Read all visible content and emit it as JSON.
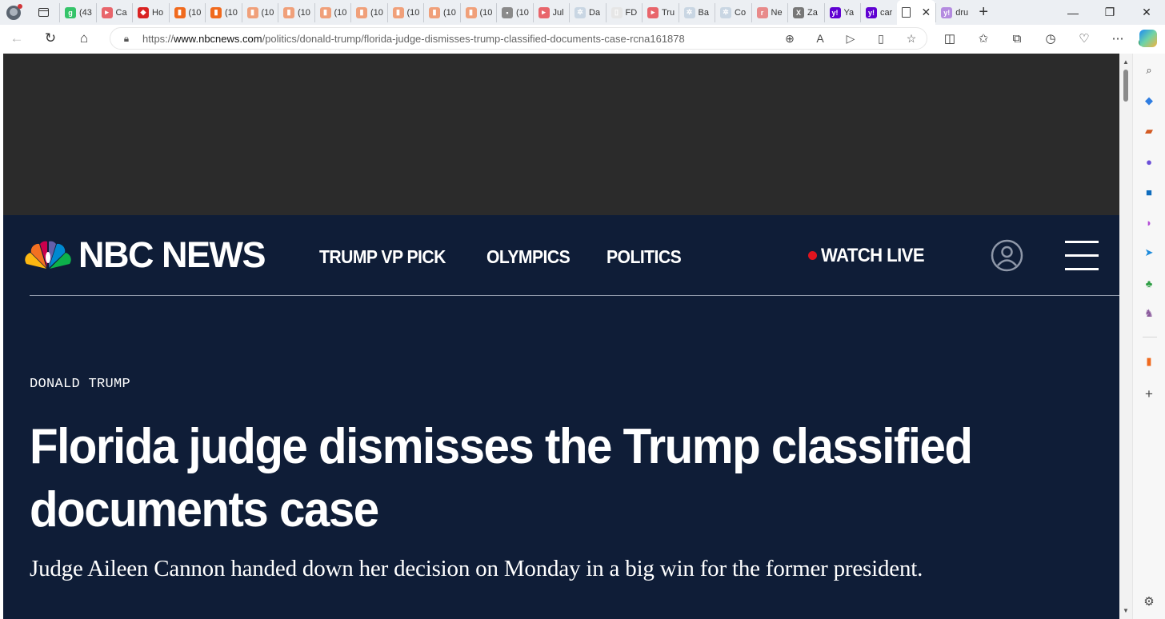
{
  "browser": {
    "tabs": [
      {
        "label": "(43",
        "color": "#35c46a",
        "glyph": "g"
      },
      {
        "label": "Ca",
        "color": "#e8656b",
        "glyph": "▸"
      },
      {
        "label": "Ho",
        "color": "#d92323",
        "glyph": "◆"
      },
      {
        "label": "(10",
        "color": "#f06a1e",
        "glyph": "▮"
      },
      {
        "label": "(10",
        "color": "#f06a1e",
        "glyph": "▮"
      },
      {
        "label": "(10",
        "color": "#f0a07a",
        "glyph": "▮"
      },
      {
        "label": "(10",
        "color": "#f0a07a",
        "glyph": "▮"
      },
      {
        "label": "(10",
        "color": "#f0a07a",
        "glyph": "▮"
      },
      {
        "label": "(10",
        "color": "#f0a07a",
        "glyph": "▮"
      },
      {
        "label": "(10",
        "color": "#f0a07a",
        "glyph": "▮"
      },
      {
        "label": "(10",
        "color": "#f0a07a",
        "glyph": "▮"
      },
      {
        "label": "(10",
        "color": "#f0a07a",
        "glyph": "▮"
      },
      {
        "label": "(10",
        "color": "#8a8a8a",
        "glyph": "▪"
      },
      {
        "label": "Jul",
        "color": "#e8656b",
        "glyph": "▸"
      },
      {
        "label": "Da",
        "color": "#c9d6e3",
        "glyph": "✲"
      },
      {
        "label": "FD",
        "color": "#e6e6e6",
        "glyph": "▯"
      },
      {
        "label": "Tru",
        "color": "#e8656b",
        "glyph": "▸"
      },
      {
        "label": "Ba",
        "color": "#c9d6e3",
        "glyph": "✲"
      },
      {
        "label": "Co",
        "color": "#c9d6e3",
        "glyph": "✲"
      },
      {
        "label": "Ne",
        "color": "#e88a8a",
        "glyph": "r"
      },
      {
        "label": "Za",
        "color": "#777777",
        "glyph": "X"
      },
      {
        "label": "Ya",
        "color": "#6001d2",
        "glyph": "y!"
      },
      {
        "label": "car",
        "color": "#6001d2",
        "glyph": "y!"
      }
    ],
    "active_tab": {
      "label": "",
      "close": "✕"
    },
    "after_tab": {
      "label": "dru",
      "color": "#b48be0",
      "glyph": "y!"
    },
    "new_tab": "+",
    "window_controls": {
      "minimize": "—",
      "restore": "❐",
      "close": "✕"
    },
    "address": {
      "prefix": "https://",
      "domain": "www.nbcnews.com",
      "path": "/politics/donald-trump/florida-judge-dismisses-trump-classified-documents-case-rcna161878"
    },
    "extensions_badge": "1",
    "sidebar_icons": [
      "search-icon",
      "tag-icon",
      "briefcase-icon",
      "games-icon",
      "outlook-icon",
      "drop-icon",
      "send-icon",
      "tree-icon",
      "chess-icon",
      "bookmark-icon",
      "add-icon",
      "settings-icon"
    ]
  },
  "site": {
    "logo": "NBC NEWS",
    "nav": [
      "TRUMP VP PICK",
      "OLYMPICS",
      "POLITICS"
    ],
    "watch_live": "WATCH LIVE",
    "colors": {
      "navy": "#0f1d37",
      "live_red": "#e0141e",
      "ad_band": "#2b2b2b"
    }
  },
  "article": {
    "eyebrow": "DONALD TRUMP",
    "headline_line1": "Florida judge dismisses the Trump classified",
    "headline_line2": "documents case",
    "dek": "Judge Aileen Cannon handed down her decision on Monday in a big win for the former president."
  }
}
